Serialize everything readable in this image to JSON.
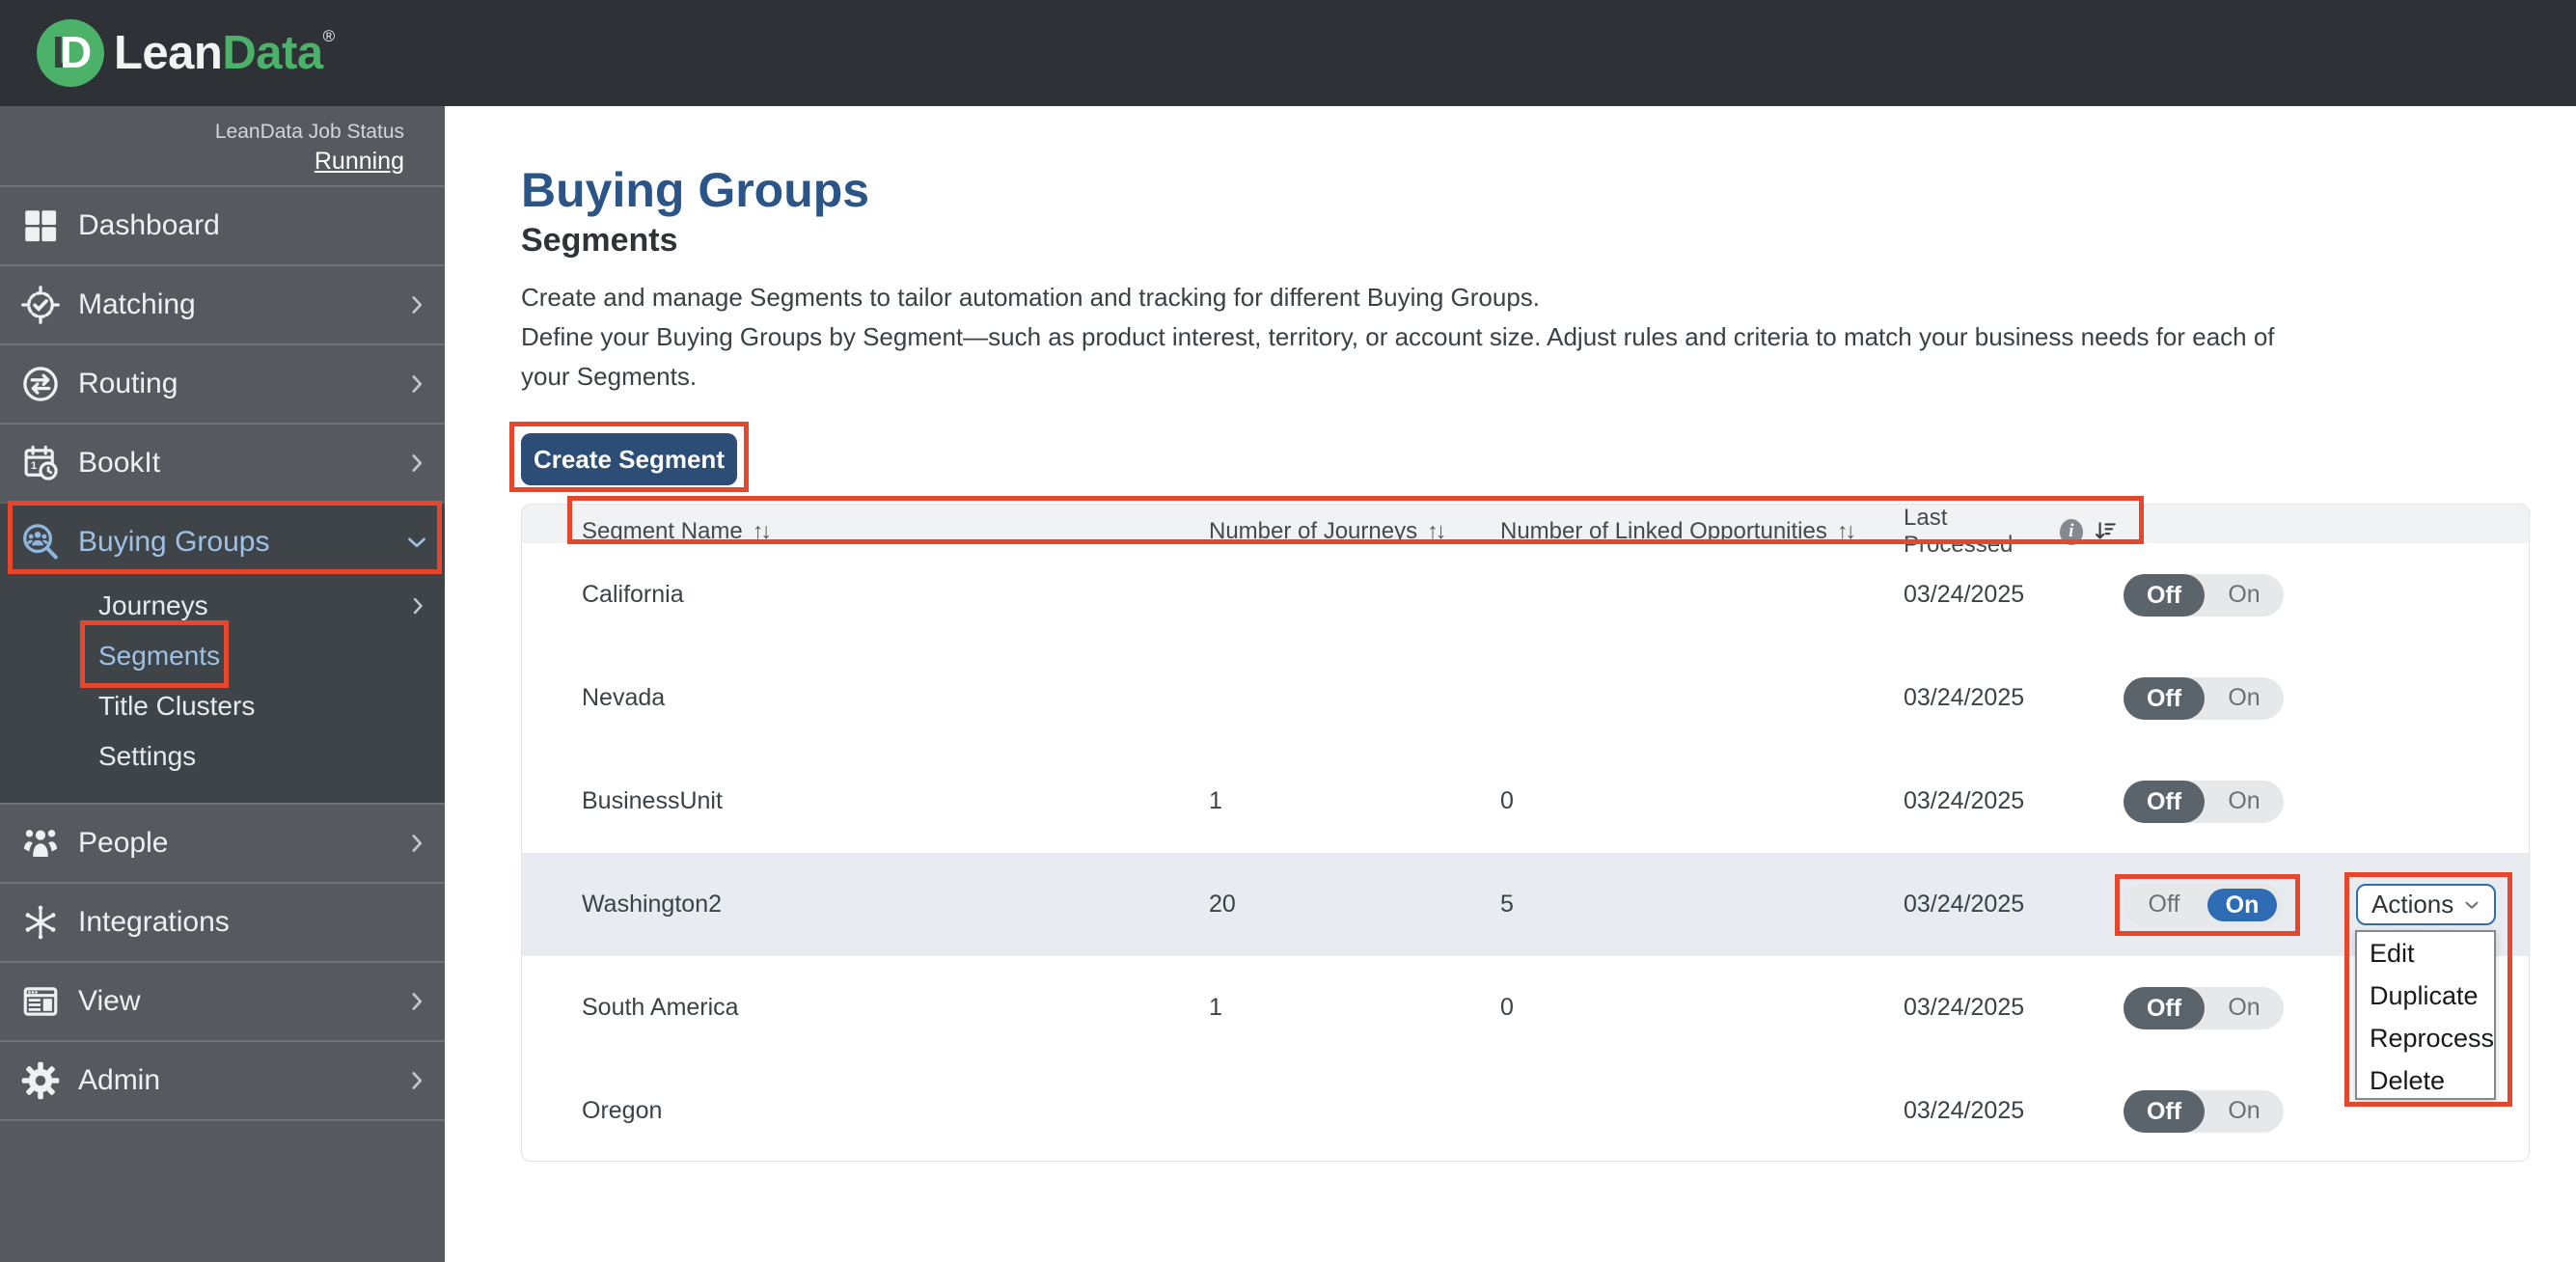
{
  "brand": {
    "mark_front": "D",
    "mark_back": "L",
    "word_lean": "Lean",
    "word_data": "Data",
    "registered": "®"
  },
  "job_status": {
    "label": "LeanData Job Status",
    "link": "Running"
  },
  "sidebar": {
    "items": [
      {
        "label": "Dashboard",
        "icon": "dashboard-icon",
        "chevron": "none"
      },
      {
        "label": "Matching",
        "icon": "matching-icon",
        "chevron": "right"
      },
      {
        "label": "Routing",
        "icon": "routing-icon",
        "chevron": "right"
      },
      {
        "label": "BookIt",
        "icon": "bookit-icon",
        "chevron": "right"
      },
      {
        "label": "Buying Groups",
        "icon": "buying-groups-icon",
        "chevron": "down",
        "active": true,
        "children": [
          {
            "label": "Journeys",
            "chevron": "right"
          },
          {
            "label": "Segments",
            "active": true
          },
          {
            "label": "Title Clusters"
          },
          {
            "label": "Settings"
          }
        ]
      },
      {
        "label": "People",
        "icon": "people-icon",
        "chevron": "right"
      },
      {
        "label": "Integrations",
        "icon": "integrations-icon",
        "chevron": "none"
      },
      {
        "label": "View",
        "icon": "view-icon",
        "chevron": "right"
      },
      {
        "label": "Admin",
        "icon": "admin-icon",
        "chevron": "right"
      }
    ]
  },
  "main": {
    "title": "Buying Groups",
    "subtitle": "Segments",
    "description_lines": [
      "Create and manage Segments to tailor automation and tracking for different Buying Groups.",
      "Define your Buying Groups by Segment—such as product interest, territory, or account size. Adjust rules and criteria to match your business needs for each of",
      "your Segments."
    ],
    "create_button": "Create Segment"
  },
  "table": {
    "headers": {
      "name": "Segment Name",
      "journeys": "Number of Journeys",
      "opportunities": "Number of Linked Opportunities",
      "last_processed": "Last Processed"
    },
    "sort_glyph": "↑↓",
    "info_glyph": "i",
    "toggle_labels": {
      "off": "Off",
      "on": "On"
    },
    "rows": [
      {
        "name": "California",
        "journeys": "",
        "opportunities": "",
        "last_processed": "03/24/2025",
        "toggle": "off"
      },
      {
        "name": "Nevada",
        "journeys": "",
        "opportunities": "",
        "last_processed": "03/24/2025",
        "toggle": "off"
      },
      {
        "name": "BusinessUnit",
        "journeys": "1",
        "opportunities": "0",
        "last_processed": "03/24/2025",
        "toggle": "off"
      },
      {
        "name": "Washington2",
        "journeys": "20",
        "opportunities": "5",
        "last_processed": "03/24/2025",
        "toggle": "on"
      },
      {
        "name": "South America",
        "journeys": "1",
        "opportunities": "0",
        "last_processed": "03/24/2025",
        "toggle": "off"
      },
      {
        "name": "Oregon",
        "journeys": "",
        "opportunities": "",
        "last_processed": "03/24/2025",
        "toggle": "off"
      }
    ],
    "actions": {
      "button": "Actions",
      "menu": [
        "Edit",
        "Duplicate",
        "Reprocess",
        "Delete"
      ]
    }
  },
  "colors": {
    "topbar_bg": "#2e3236",
    "sidebar_bg": "#565a5e",
    "sidebar_active_bg": "#3f4448",
    "sidebar_active_text": "#9dc2e6",
    "brand_green": "#4cb269",
    "title_blue": "#2b5587",
    "button_blue": "#2b4d76",
    "accent_blue": "#2e6db4",
    "toggle_off_dark": "#5b636b",
    "header_bg": "#f1f2f3",
    "row_highlight": "#e8ebf0",
    "annotation_red": "#e5462c"
  }
}
